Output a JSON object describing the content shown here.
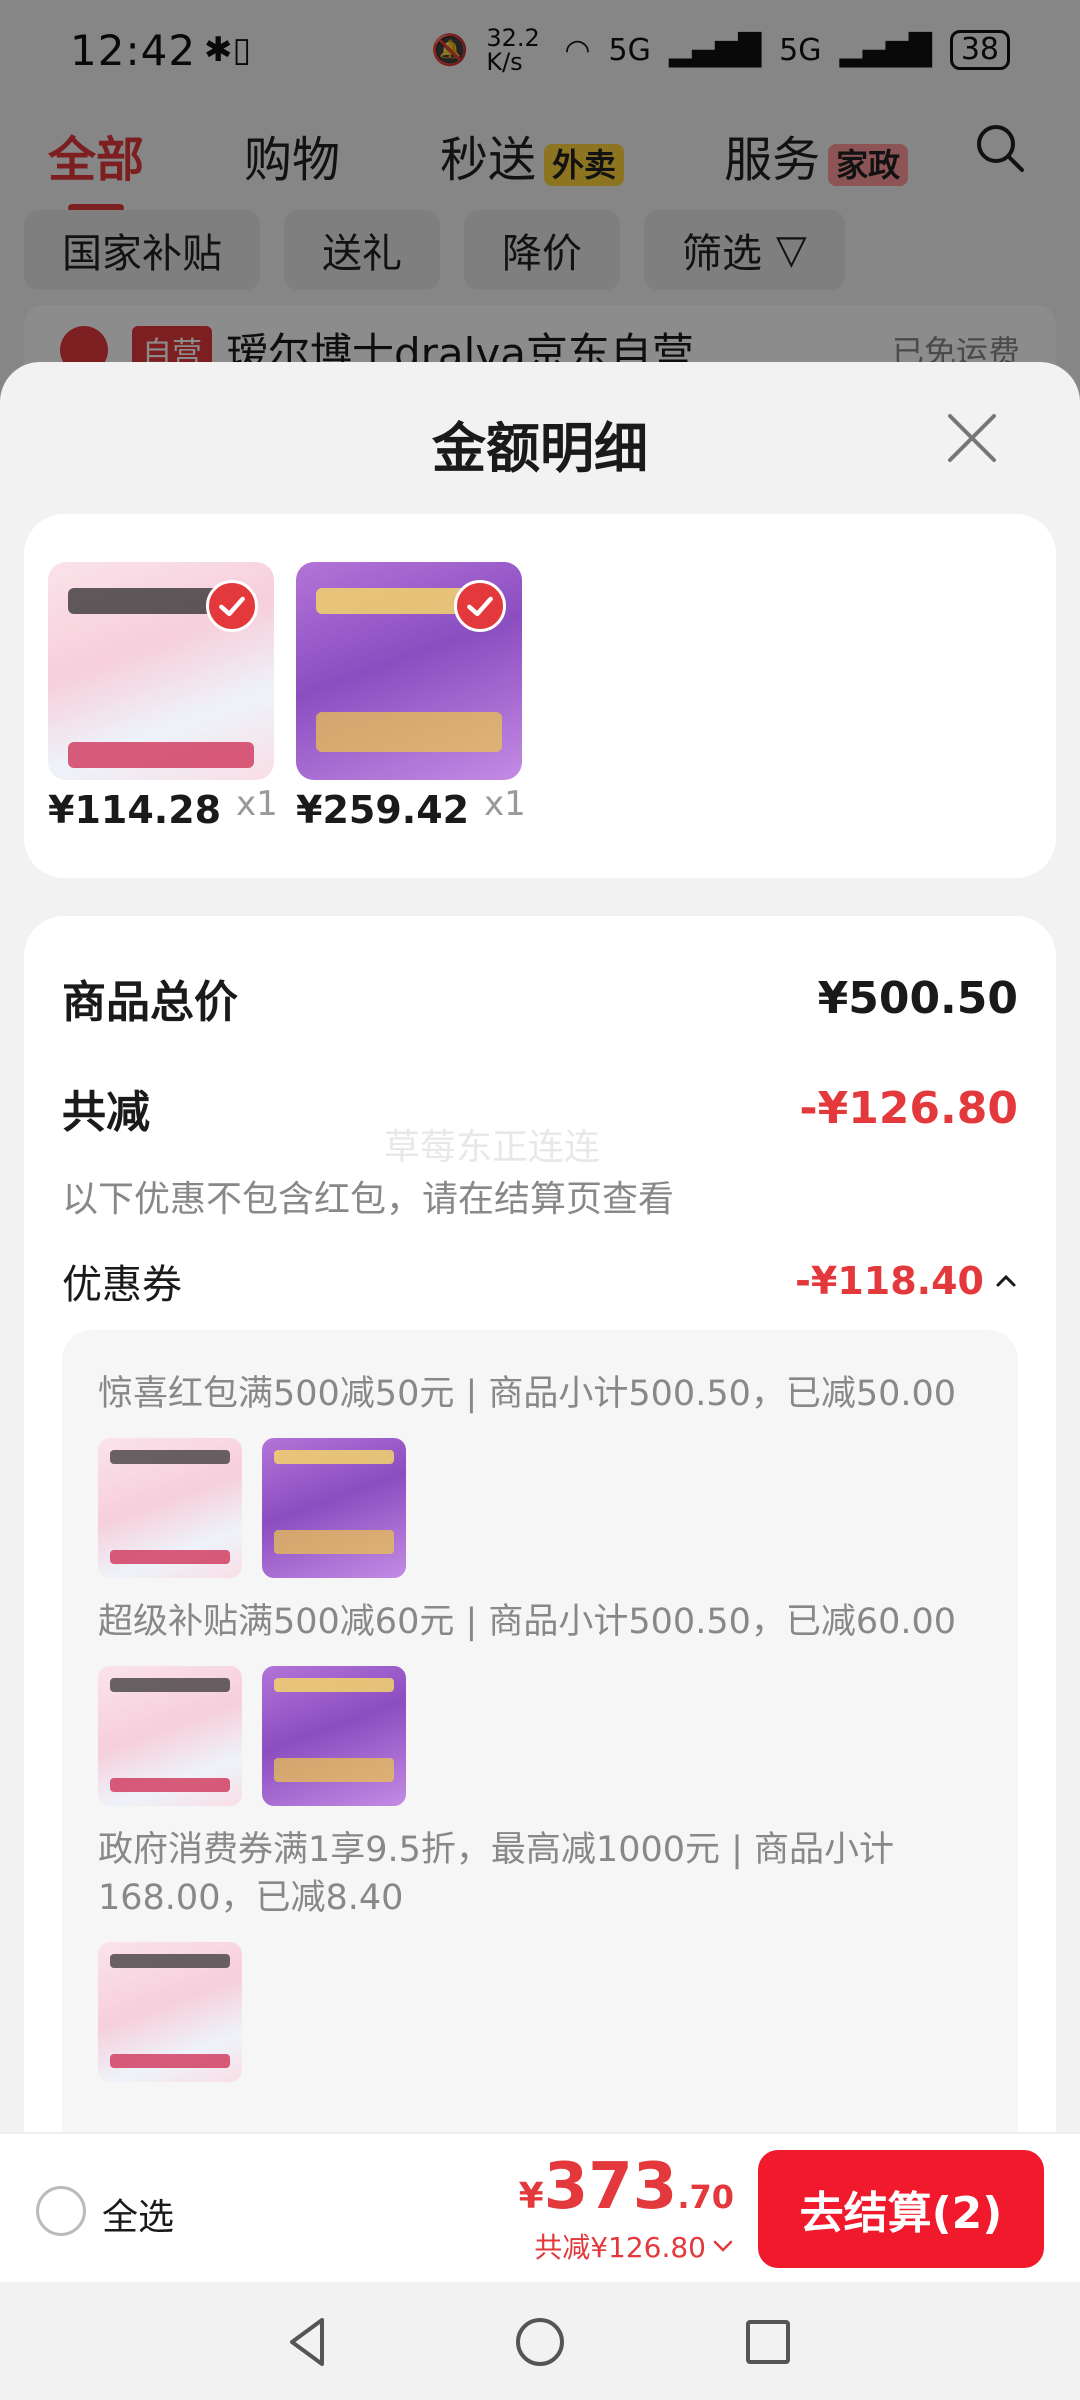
{
  "status_bar": {
    "time": "12:42",
    "net_speed": "32.2 K/s",
    "signal1": "5G",
    "signal2": "5G",
    "battery": "38"
  },
  "tabs": [
    {
      "label": "全部"
    },
    {
      "label": "购物"
    },
    {
      "label": "秒送",
      "badge": "外卖"
    },
    {
      "label": "服务",
      "badge": "家政"
    }
  ],
  "filters": [
    "国家补贴",
    "送礼",
    "降价",
    "筛选"
  ],
  "store": {
    "tag": "自营",
    "name": "瑷尔博士dralva京东自营",
    "shipping": "已免运费"
  },
  "sheet": {
    "title": "金额明细",
    "products": [
      {
        "price": "¥114.28",
        "qty": "x1"
      },
      {
        "price": "¥259.42",
        "qty": "x1"
      }
    ],
    "total_label": "商品总价",
    "total_value": "¥500.50",
    "discount_label": "共减",
    "discount_value": "-¥126.80",
    "discount_note": "以下优惠不包含红包，请在结算页查看",
    "watermark": "草莓东正连连",
    "coupon_label": "优惠券",
    "coupon_value": "-¥118.40",
    "coupons": [
      {
        "text": "惊喜红包满500减50元 | 商品小计500.50，已减50.00"
      },
      {
        "text": "超级补贴满500减60元 | 商品小计500.50，已减60.00"
      },
      {
        "text": "政府消费券满1享9.5折，最高减1000元 | 商品小计168.00，已减8.40"
      }
    ]
  },
  "bottom": {
    "select_all": "全选",
    "currency": "¥",
    "total_int": "373",
    "total_dec": ".70",
    "savings": "共减¥126.80",
    "checkout": "去结算(2)"
  },
  "colors": {
    "accent": "#e4393c",
    "checkout": "#f01a2c"
  }
}
